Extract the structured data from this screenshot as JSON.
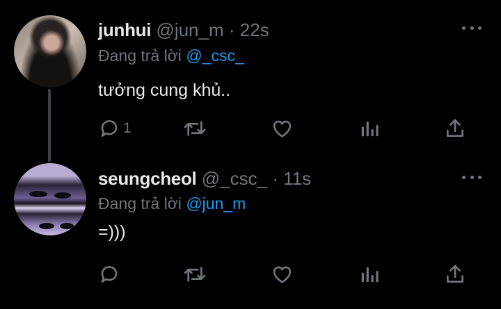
{
  "tweets": [
    {
      "name": "junhui",
      "handle": "@jun_m",
      "separator": "·",
      "time": "22s",
      "reply_prefix": "Đang trả lời",
      "reply_to": "@_csc_",
      "text": "tưởng cung khủ..",
      "reply_count": "1",
      "icons": [
        "reply-icon",
        "retweet-icon",
        "like-icon",
        "views-icon",
        "share-icon",
        "more-icon"
      ]
    },
    {
      "name": "seungcheol",
      "handle": "@_csc_",
      "separator": "·",
      "time": "11s",
      "reply_prefix": "Đang trả lời",
      "reply_to": "@jun_m",
      "text": "=)))",
      "reply_count": "",
      "icons": [
        "reply-icon",
        "retweet-icon",
        "like-icon",
        "views-icon",
        "share-icon",
        "more-icon"
      ]
    }
  ],
  "colors": {
    "background": "#000000",
    "text": "#e7e9ea",
    "secondary": "#71767b",
    "accent": "#1d9bf0",
    "thread_line": "#3e4144"
  }
}
